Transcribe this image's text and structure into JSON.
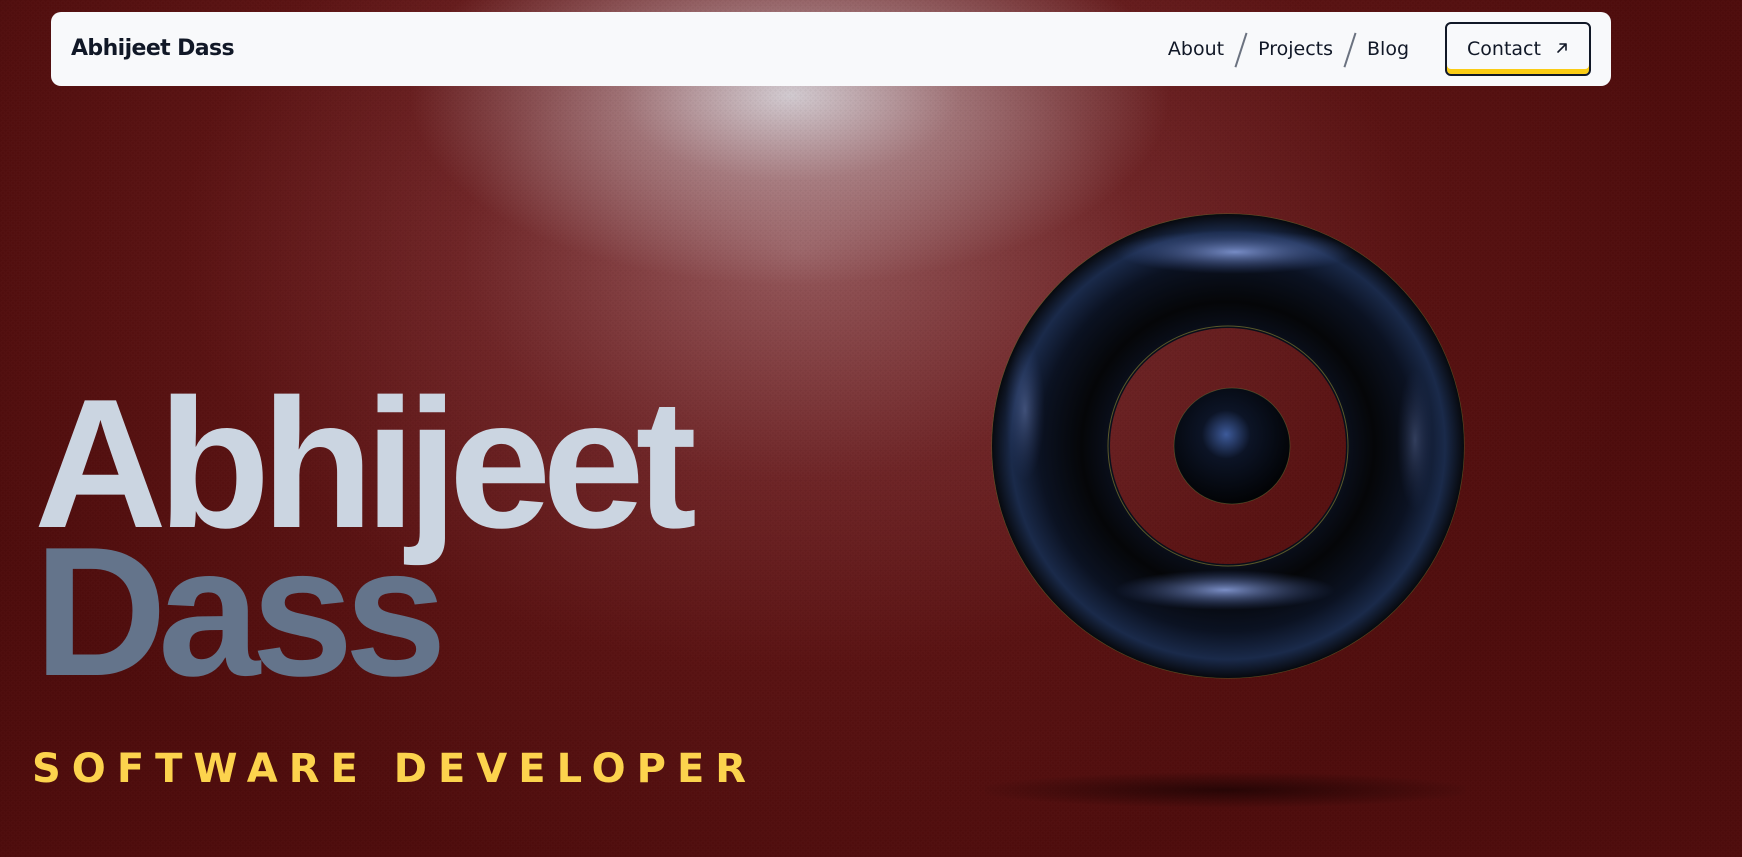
{
  "navbar": {
    "brand": "Abhijeet Dass",
    "links": [
      {
        "label": "About"
      },
      {
        "label": "Projects"
      },
      {
        "label": "Blog"
      }
    ],
    "contact": {
      "label": "Contact",
      "icon": "arrow-up-right-icon"
    }
  },
  "hero": {
    "first_name": "Abhijeet",
    "last_name": "Dass",
    "role": "SOFTWARE DEVELOPER"
  },
  "colors": {
    "background": "#4e0c0c",
    "navbar_bg": "#f8f9fb",
    "first_name": "#cbd5e1",
    "last_name": "#64748b",
    "role": "#fcd34d",
    "contact_underline": "#facc15"
  }
}
